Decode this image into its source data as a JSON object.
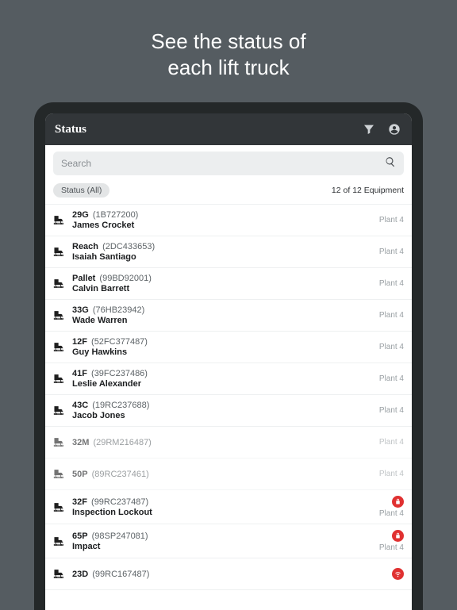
{
  "promo": {
    "line1": "See the status of",
    "line2": "each lift truck"
  },
  "header": {
    "title": "Status"
  },
  "search": {
    "placeholder": "Search"
  },
  "filter": {
    "chip": "Status (All)",
    "count": "12 of 12 Equipment"
  },
  "rows": [
    {
      "name": "29G",
      "id": "(1B727200)",
      "sub": "James Crocket",
      "loc": "Plant 4",
      "dim": false,
      "status": ""
    },
    {
      "name": "Reach",
      "id": "(2DC433653)",
      "sub": "Isaiah Santiago",
      "loc": "Plant 4",
      "dim": false,
      "status": ""
    },
    {
      "name": "Pallet",
      "id": "(99BD92001)",
      "sub": "Calvin Barrett",
      "loc": "Plant 4",
      "dim": false,
      "status": ""
    },
    {
      "name": "33G",
      "id": "(76HB23942)",
      "sub": "Wade Warren",
      "loc": "Plant 4",
      "dim": false,
      "status": ""
    },
    {
      "name": "12F",
      "id": "(52FC377487)",
      "sub": "Guy Hawkins",
      "loc": "Plant 4",
      "dim": false,
      "status": ""
    },
    {
      "name": "41F",
      "id": "(39FC237486)",
      "sub": "Leslie Alexander",
      "loc": "Plant 4",
      "dim": false,
      "status": ""
    },
    {
      "name": "43C",
      "id": "(19RC237688)",
      "sub": "Jacob Jones",
      "loc": "Plant 4",
      "dim": false,
      "status": ""
    },
    {
      "name": "32M",
      "id": "(29RM216487)",
      "sub": "",
      "loc": "Plant 4",
      "dim": true,
      "status": ""
    },
    {
      "name": "50P",
      "id": "(89RC237461)",
      "sub": "",
      "loc": "Plant 4",
      "dim": true,
      "status": ""
    },
    {
      "name": "32F",
      "id": "(99RC237487)",
      "sub": "Inspection Lockout",
      "loc": "Plant 4",
      "dim": false,
      "status": "lock"
    },
    {
      "name": "65P",
      "id": "(98SP247081)",
      "sub": "Impact",
      "loc": "Plant 4",
      "dim": false,
      "status": "lock"
    },
    {
      "name": "23D",
      "id": "(99RC167487)",
      "sub": "",
      "loc": "",
      "dim": false,
      "status": "wifi"
    }
  ]
}
